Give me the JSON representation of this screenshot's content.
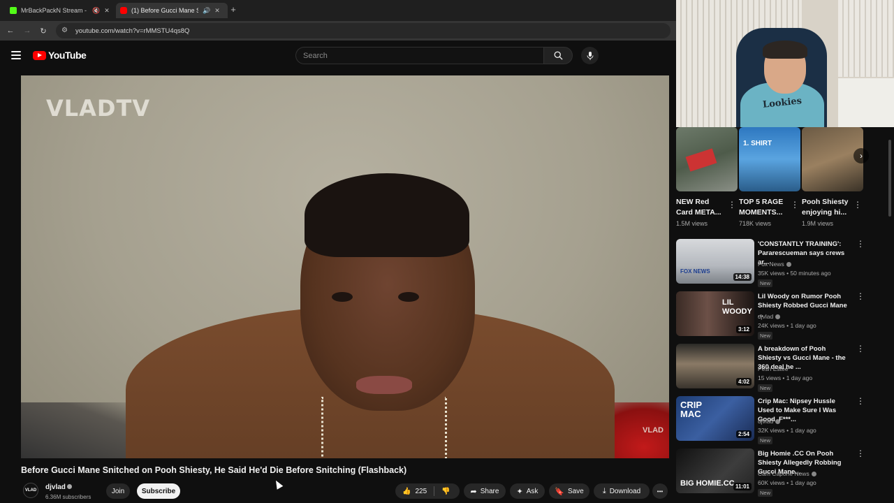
{
  "browser": {
    "tabs": [
      {
        "title": "MrBackPackN Stream - Wa",
        "favicon_color": "#53fc18"
      },
      {
        "title": "(1) Before Gucci Mane Snit",
        "favicon_color": "#ff0000"
      }
    ],
    "new_tab": "+",
    "url": "youtube.com/watch?v=rMMSTU4qs8Q"
  },
  "youtube": {
    "logo_text": "YouTube",
    "search_placeholder": "Search"
  },
  "video": {
    "logo_overlay": "VLADTV",
    "watermark": "VLAD",
    "title": "Before Gucci Mane Snitched on Pooh Shiesty, He Said He'd Die Before Snitching (Flashback)",
    "channel": "djvlad",
    "avatar_text": "VLAD",
    "subscribers": "6.36M subscribers",
    "join_label": "Join",
    "subscribe_label": "Subscribe",
    "likes": "225",
    "share_label": "Share",
    "ask_label": "Ask",
    "save_label": "Save",
    "download_label": "Download",
    "more_label": "•••"
  },
  "webcam": {
    "shirt_text": "Lookies"
  },
  "rec_row": [
    {
      "title": "NEW Red Card META...",
      "views": "1.5M views"
    },
    {
      "title": "TOP 5 RAGE MOMENTS...",
      "views": "718K views",
      "thumb_text": "1. SHIRT"
    },
    {
      "title": "Pooh Shiesty enjoying hi...",
      "views": "1.9M views"
    }
  ],
  "recommendations": [
    {
      "title": "'CONSTANTLY TRAINING': Pararescueman says crews ar...",
      "channel": "Fox News",
      "meta": "35K views • 50 minutes ago",
      "badge": "New",
      "duration": "14:38",
      "thumb_text": "FOX NEWS"
    },
    {
      "title": "Lil Woody on Rumor Pooh Shiesty Robbed Gucci Mane ...",
      "channel": "djvlad",
      "meta": "24K views • 1 day ago",
      "badge": "New",
      "duration": "3:12",
      "thumb_text": "LIL WOODY"
    },
    {
      "title": "A breakdown of Pooh Shiesty vs Gucci Mane - the 360 deal he ...",
      "channel": "Pesh Estee",
      "meta": "15 views • 1 day ago",
      "badge": "New",
      "duration": "4:02",
      "thumb_text": ""
    },
    {
      "title": "Crip Mac: Nipsey Hussle Used to Make Sure I Was Good, F***...",
      "channel": "djvlad",
      "meta": "32K views • 1 day ago",
      "badge": "New",
      "duration": "2:54",
      "thumb_text": "CRIP MAC"
    },
    {
      "title": "Big Homie .CC On Pooh Shiesty Allegedly Robbing Gucci Mane...",
      "channel": "Cam Capone News",
      "meta": "60K views • 1 day ago",
      "badge": "New",
      "duration": "11:01",
      "thumb_text": "BIG HOMIE.CC"
    }
  ]
}
